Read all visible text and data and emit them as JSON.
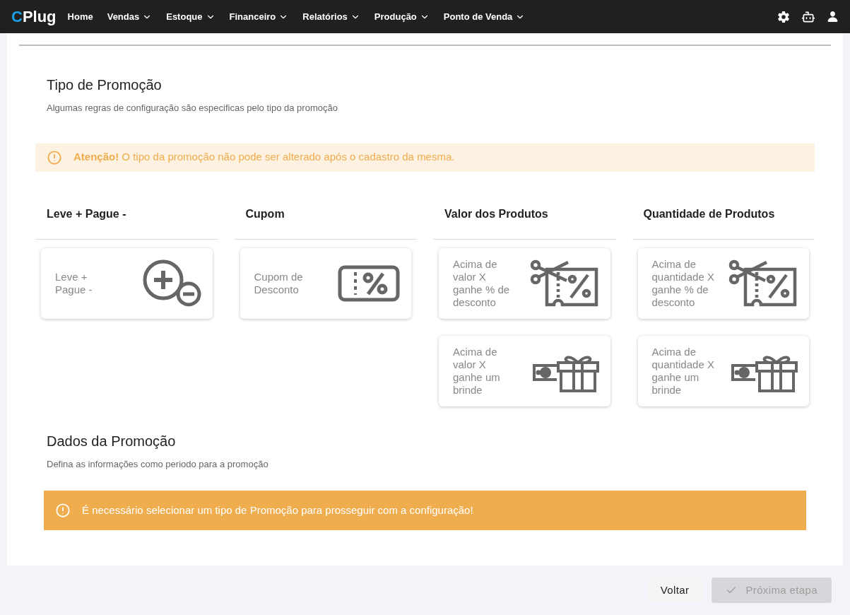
{
  "nav": {
    "logo": "CPlug",
    "items": [
      {
        "label": "Home",
        "dropdown": false
      },
      {
        "label": "Vendas",
        "dropdown": true
      },
      {
        "label": "Estoque",
        "dropdown": true
      },
      {
        "label": "Financeiro",
        "dropdown": true
      },
      {
        "label": "Relatórios",
        "dropdown": true
      },
      {
        "label": "Produção",
        "dropdown": true
      },
      {
        "label": "Ponto de Venda",
        "dropdown": true
      }
    ]
  },
  "tipo": {
    "title": "Tipo de Promoção",
    "subtitle": "Algumas regras de configuração são especificas pelo tipo da promoção",
    "alert": "**Atenção!** O tipo da promoção não pode ser alterado após o cadastro da mesma."
  },
  "groups": [
    {
      "title": "Leve + Pague -",
      "options": [
        {
          "label": "Leve + Pague -",
          "kind": "plusminus",
          "selected": false
        }
      ]
    },
    {
      "title": "Cupom",
      "options": [
        {
          "label": "Cupom de Desconto",
          "kind": "coupon",
          "selected": false
        }
      ]
    },
    {
      "title": "Valor dos Produtos",
      "options": [
        {
          "label": "Acima de valor X ganhe % de desconto",
          "kind": "scissors",
          "selected": false
        },
        {
          "label": "Acima de valor X ganhe um brinde",
          "kind": "gift",
          "selected": false
        }
      ]
    },
    {
      "title": "Quantidade de Produtos",
      "options": [
        {
          "label": "Acima de quantidade X ganhe % de desconto",
          "kind": "scissors",
          "selected": false
        },
        {
          "label": "Acima de quantidade X ganhe um brinde",
          "kind": "gift",
          "selected": false
        }
      ]
    }
  ],
  "dados": {
    "title": "Dados da Promoção",
    "subtitle": "Defina as informações como periodo para a promoção",
    "alert": "É necessário selecionar um tipo de Promoção para prosseguir com a configuração!"
  },
  "footer": {
    "buttons": [
      {
        "label": "Voltar",
        "kind": "back",
        "disabled": false
      },
      {
        "label": "Próxima etapa",
        "kind": "next",
        "disabled": true
      }
    ]
  }
}
